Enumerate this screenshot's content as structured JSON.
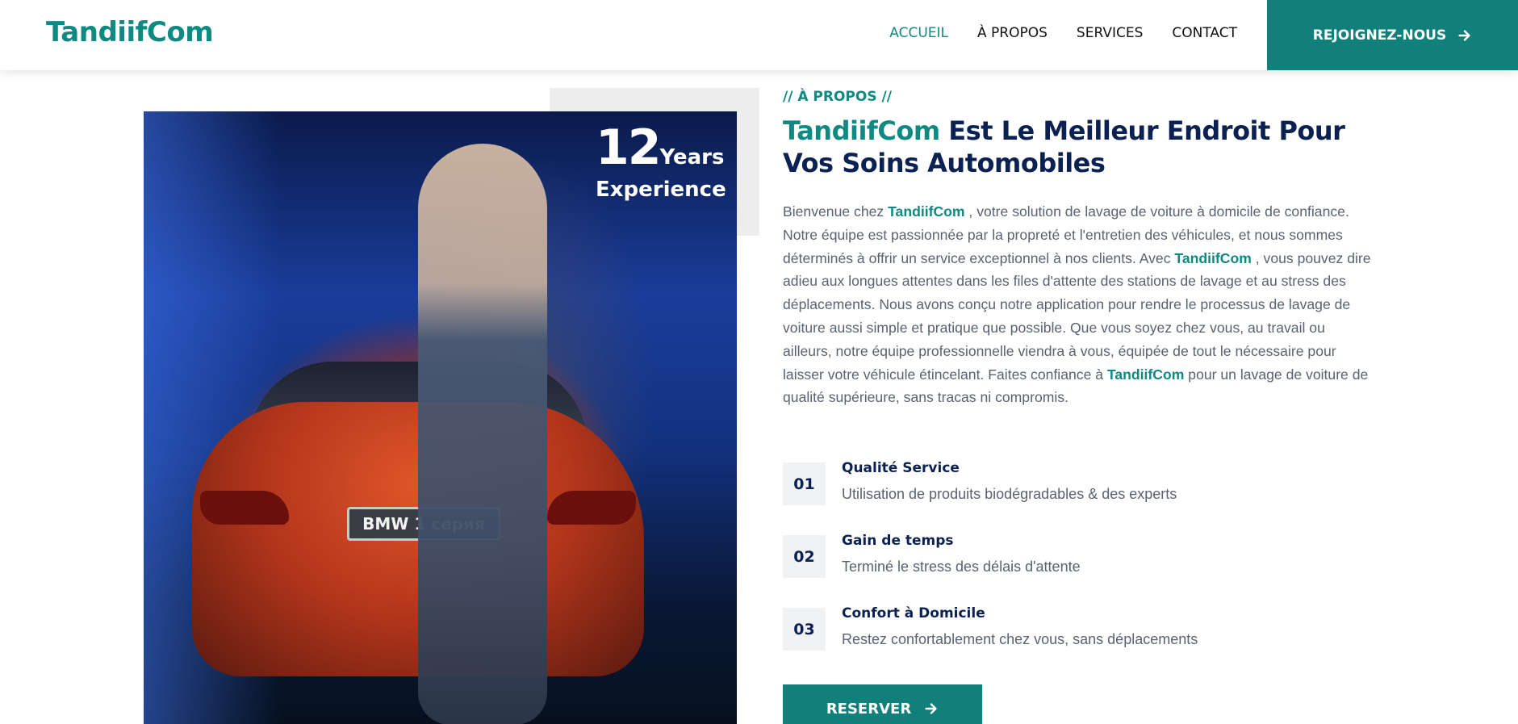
{
  "brand": {
    "name": "TandiifCom",
    "color": "#0f8a82"
  },
  "nav": {
    "items": [
      {
        "label": "ACCUEIL",
        "active": true
      },
      {
        "label": "À PROPOS"
      },
      {
        "label": "SERVICES"
      },
      {
        "label": "CONTACT"
      }
    ],
    "cta_label": "REJOIGNEZ-NOUS",
    "cta_icon": "arrow-right-icon"
  },
  "hero": {
    "experience_number": "12",
    "experience_unit": "Years",
    "experience_label": "Experience",
    "plate_text": "BMW 1 серия"
  },
  "about": {
    "eyebrow": "// À PROPOS //",
    "title_brand": "TandiifCom",
    "title_rest": " Est Le Meilleur Endroit Pour Vos Soins Automobiles",
    "paragraph": {
      "p1": "Bienvenue chez ",
      "b1": "TandiifCom",
      "p2": " , votre solution de lavage de voiture à domicile de confiance. Notre équipe est passionnée par la propreté et l'entretien des véhicules, et nous sommes déterminés à offrir un service exceptionnel à nos clients. Avec ",
      "b2": "TandiifCom",
      "p3": " , vous pouvez dire adieu aux longues attentes dans les files d'attente des stations de lavage et au stress des déplacements. Nous avons conçu notre application pour rendre le processus de lavage de voiture aussi simple et pratique que possible. Que vous soyez chez vous, au travail ou ailleurs, notre équipe professionnelle viendra à vous, équipée de tout le nécessaire pour laisser votre véhicule étincelant. Faites confiance à ",
      "b3": "TandiifCom",
      "p4": " pour un lavage de voiture de qualité supérieure, sans tracas ni compromis."
    },
    "features": [
      {
        "num": "01",
        "title": "Qualité Service",
        "desc": "Utilisation de produits biodégradables & des experts"
      },
      {
        "num": "02",
        "title": "Gain de temps",
        "desc": "Terminé le stress des délais d'attente"
      },
      {
        "num": "03",
        "title": "Confort à Domicile",
        "desc": "Restez confortablement chez vous, sans déplacements"
      }
    ],
    "cta_label": "RESERVER",
    "cta_icon": "arrow-right-icon"
  },
  "colors": {
    "accent": "#11807a",
    "heading": "#0b2152",
    "text": "#5a6270",
    "badge_bg": "#f1f2f4"
  }
}
